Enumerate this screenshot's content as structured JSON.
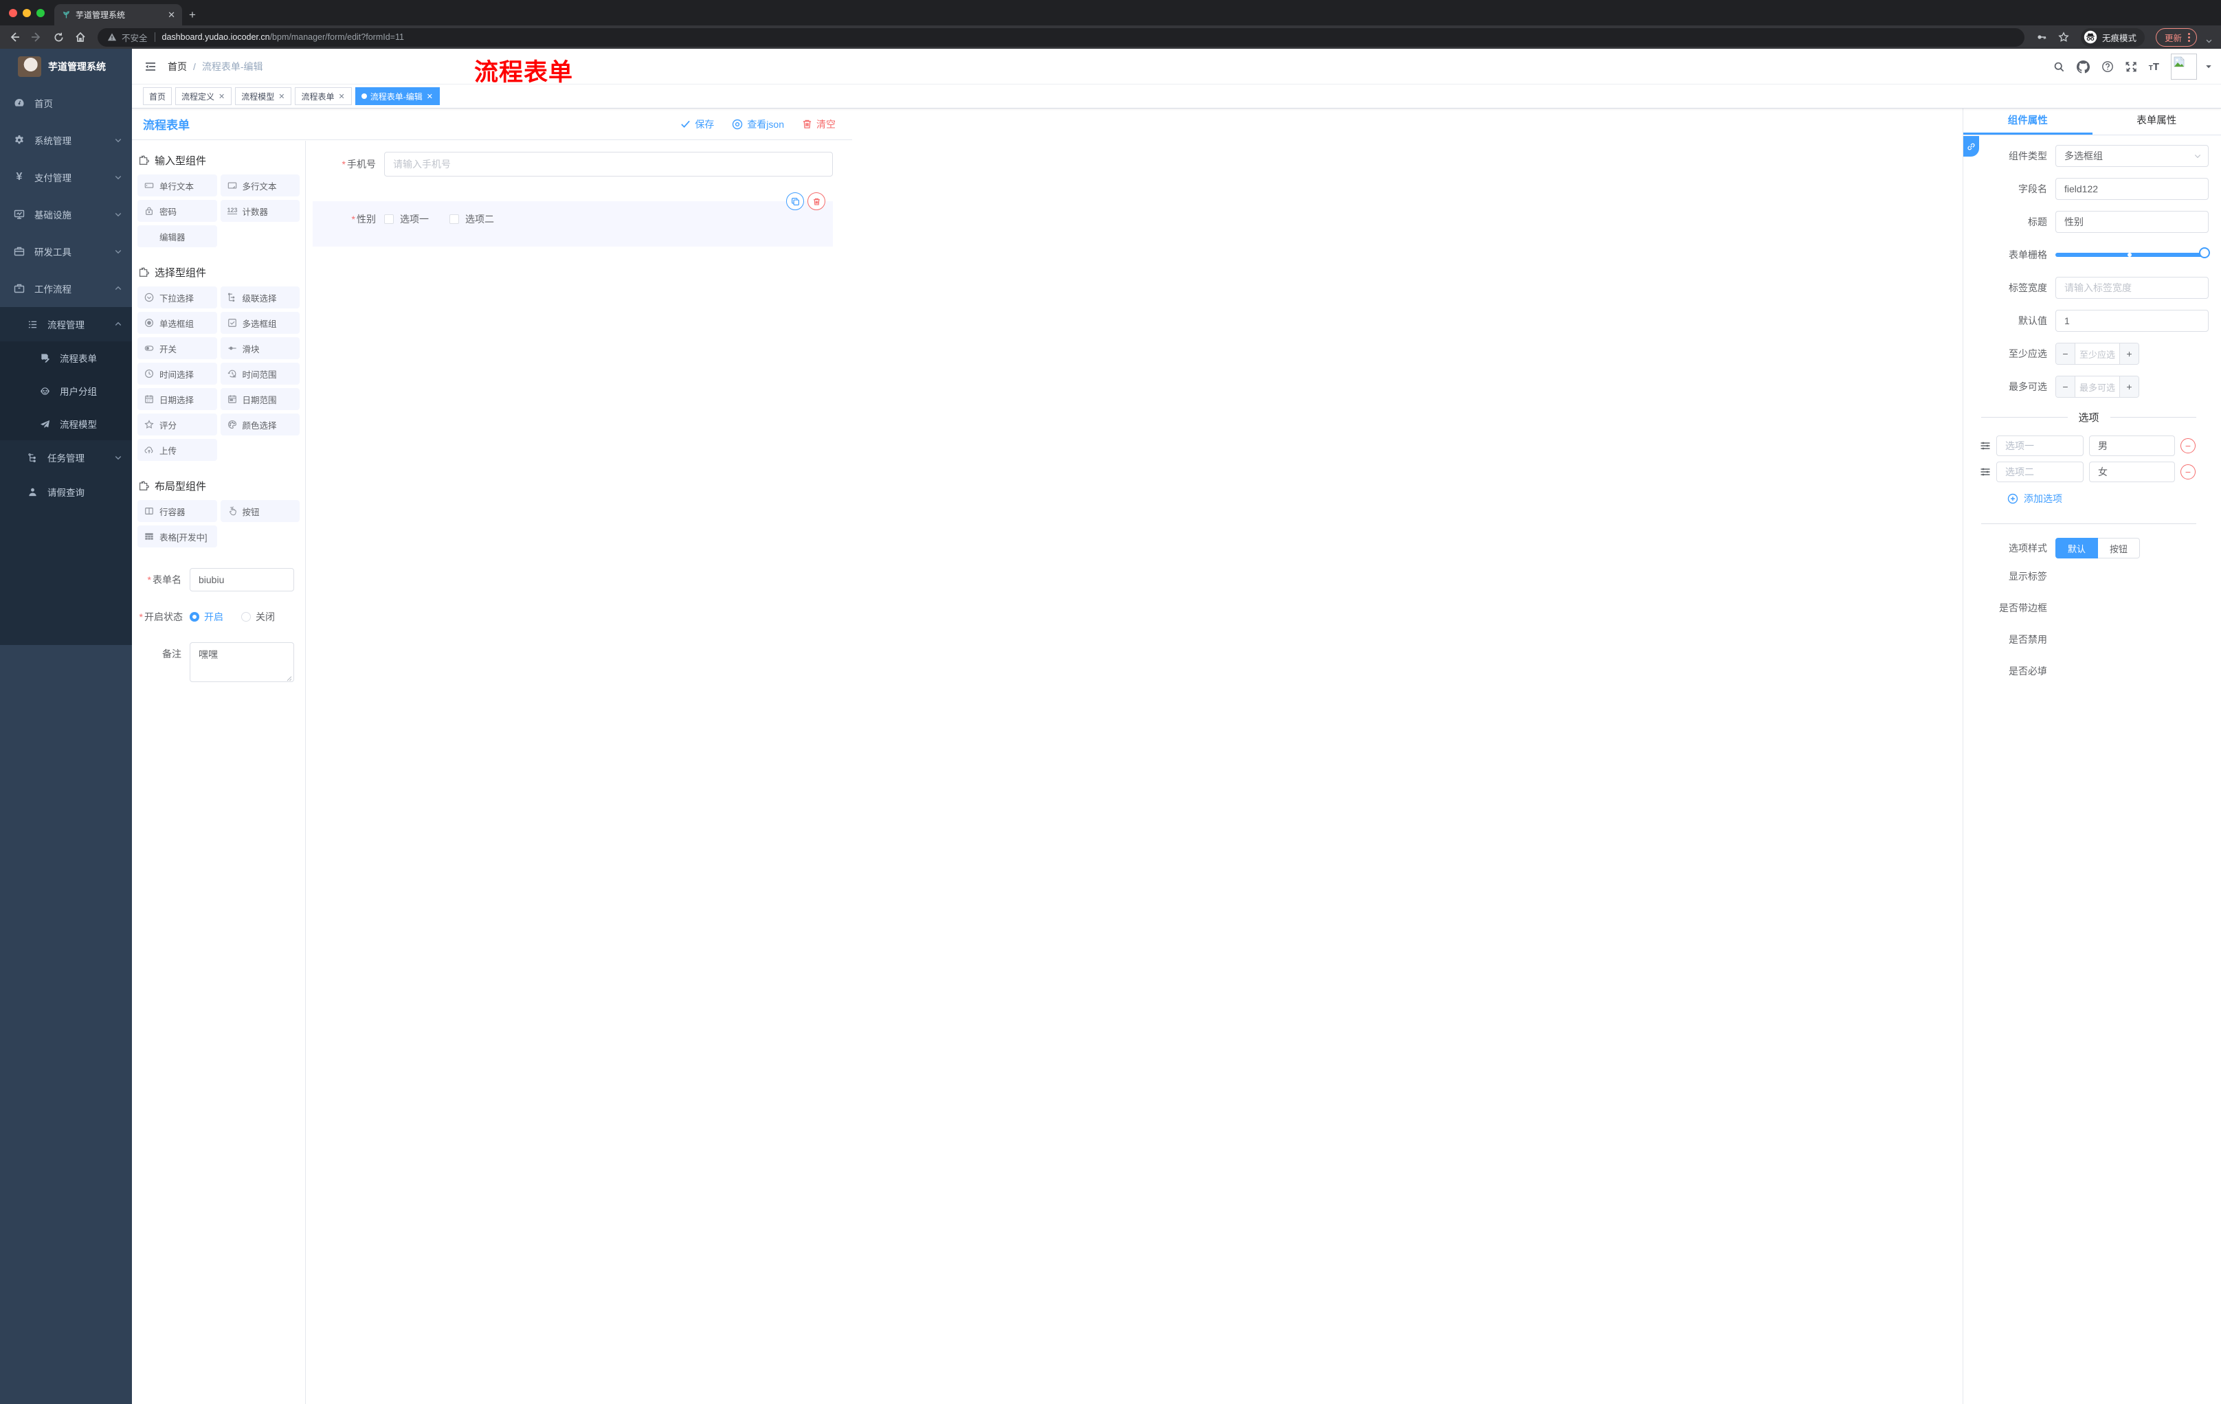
{
  "browser": {
    "tab_title": "芋道管理系统",
    "security_label": "不安全",
    "url_host": "dashboard.yudao.iocoder.cn",
    "url_path": "/bpm/manager/form/edit?formId=11",
    "incognito_label": "无痕模式",
    "update_label": "更新"
  },
  "sidebar": {
    "app_title": "芋道管理系统",
    "items": [
      {
        "label": "首页"
      },
      {
        "label": "系统管理"
      },
      {
        "label": "支付管理"
      },
      {
        "label": "基础设施"
      },
      {
        "label": "研发工具"
      },
      {
        "label": "工作流程"
      },
      {
        "label": "流程管理"
      },
      {
        "label": "流程表单"
      },
      {
        "label": "用户分组"
      },
      {
        "label": "流程模型"
      },
      {
        "label": "任务管理"
      },
      {
        "label": "请假查询"
      }
    ]
  },
  "navbar": {
    "breadcrumb_home": "首页",
    "breadcrumb_current": "流程表单-编辑",
    "watermark": "流程表单"
  },
  "tags": [
    {
      "label": "首页"
    },
    {
      "label": "流程定义"
    },
    {
      "label": "流程模型"
    },
    {
      "label": "流程表单"
    },
    {
      "label": "流程表单-编辑"
    }
  ],
  "designer": {
    "title": "流程表单",
    "save_label": "保存",
    "view_json_label": "查看json",
    "clear_label": "清空"
  },
  "components_panel": {
    "sections": [
      {
        "title": "输入型组件",
        "items": [
          "单行文本",
          "多行文本",
          "密码",
          "计数器",
          "编辑器"
        ]
      },
      {
        "title": "选择型组件",
        "items": [
          "下拉选择",
          "级联选择",
          "单选框组",
          "多选框组",
          "开关",
          "滑块",
          "时间选择",
          "时间范围",
          "日期选择",
          "日期范围",
          "评分",
          "颜色选择",
          "上传"
        ]
      },
      {
        "title": "布局型组件",
        "items": [
          "行容器",
          "按钮",
          "表格[开发中]"
        ]
      }
    ],
    "form": {
      "name_label": "表单名",
      "name_value": "biubiu",
      "status_label": "开启状态",
      "status_on": "开启",
      "status_off": "关闭",
      "remark_label": "备注",
      "remark_value": "嘿嘿"
    }
  },
  "canvas": {
    "phone": {
      "label": "手机号",
      "placeholder": "请输入手机号"
    },
    "gender": {
      "label": "性别",
      "options": [
        "选项一",
        "选项二"
      ]
    }
  },
  "props_panel": {
    "tabs": [
      "组件属性",
      "表单属性"
    ],
    "fields": {
      "type_label": "组件类型",
      "type_value": "多选框组",
      "field_label": "字段名",
      "field_value": "field122",
      "title_label": "标题",
      "title_value": "性别",
      "grid_label": "表单栅格",
      "width_label": "标签宽度",
      "width_placeholder": "请输入标签宽度",
      "default_label": "默认值",
      "default_value": "1",
      "min_label": "至少应选",
      "min_placeholder": "至少应选",
      "max_label": "最多可选",
      "max_placeholder": "最多可选"
    },
    "options": {
      "divider_title": "选项",
      "rows": [
        {
          "label": "选项一",
          "value": "男"
        },
        {
          "label": "选项二",
          "value": "女"
        }
      ],
      "add_label": "添加选项",
      "style_label": "选项样式",
      "style_default": "默认",
      "style_button": "按钮",
      "toggle_show_label": "显示标签",
      "toggle_border": "是否带边框",
      "toggle_disabled": "是否禁用",
      "toggle_required": "是否必填"
    }
  },
  "colors": {
    "accent": "#409eff",
    "danger": "#f56c6c",
    "watermark": "#fe0000",
    "sidebar_bg": "#304156",
    "submenu_bg": "#1f2d3d",
    "chrome_bg": "#202124",
    "toolbar_bg": "#35363a"
  }
}
